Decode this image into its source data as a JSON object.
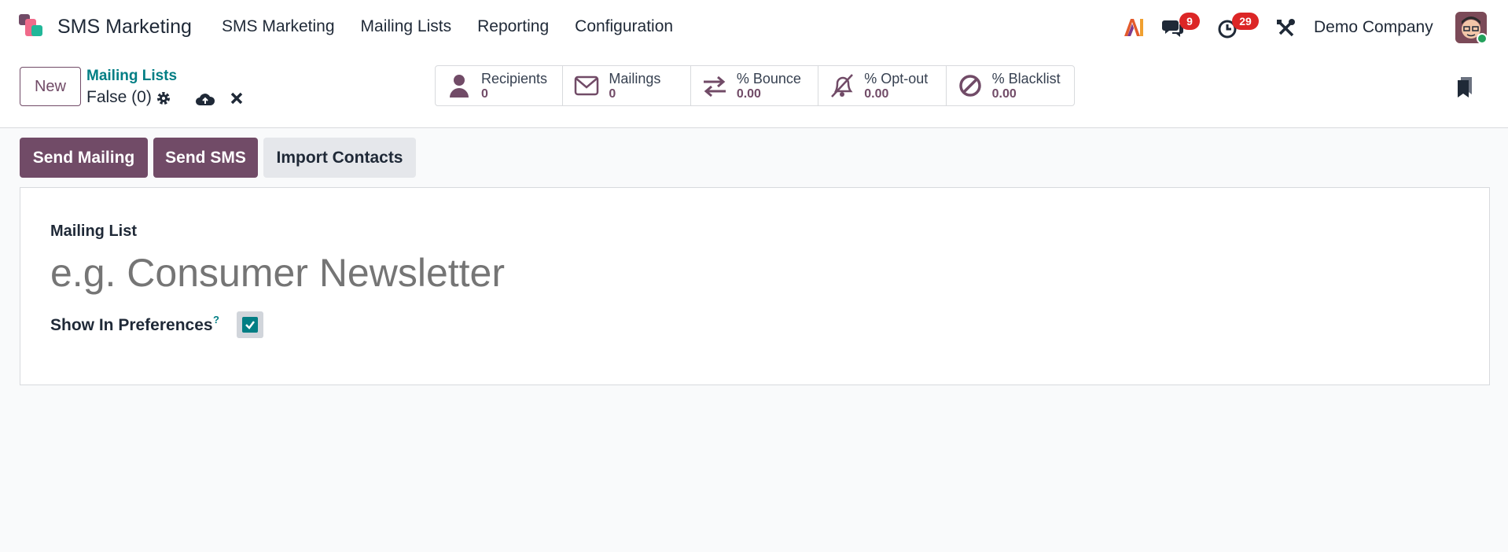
{
  "navbar": {
    "app_name": "SMS Marketing",
    "menu": [
      "SMS Marketing",
      "Mailing Lists",
      "Reporting",
      "Configuration"
    ],
    "chat_count": "9",
    "activity_count": "29",
    "company": "Demo Company"
  },
  "control": {
    "new_label": "New",
    "breadcrumb": "Mailing Lists",
    "record_name": "False (0)",
    "stats": [
      {
        "label": "Recipients",
        "value": "0",
        "icon": "user-icon"
      },
      {
        "label": "Mailings",
        "value": "0",
        "icon": "envelope-icon"
      },
      {
        "label": "% Bounce",
        "value": "0.00",
        "icon": "exchange-icon"
      },
      {
        "label": "% Opt-out",
        "value": "0.00",
        "icon": "bell-slash-icon"
      },
      {
        "label": "% Blacklist",
        "value": "0.00",
        "icon": "ban-icon"
      }
    ]
  },
  "actions": {
    "send_mailing": "Send Mailing",
    "send_sms": "Send SMS",
    "import_contacts": "Import Contacts"
  },
  "form": {
    "name_label": "Mailing List",
    "name_placeholder": "e.g. Consumer Newsletter",
    "name_value": "",
    "pref_label": "Show In Preferences",
    "help": "?",
    "show_in_preferences": true
  },
  "colors": {
    "primary": "#714b67",
    "accent": "#017e84",
    "badge": "#dc2626"
  }
}
